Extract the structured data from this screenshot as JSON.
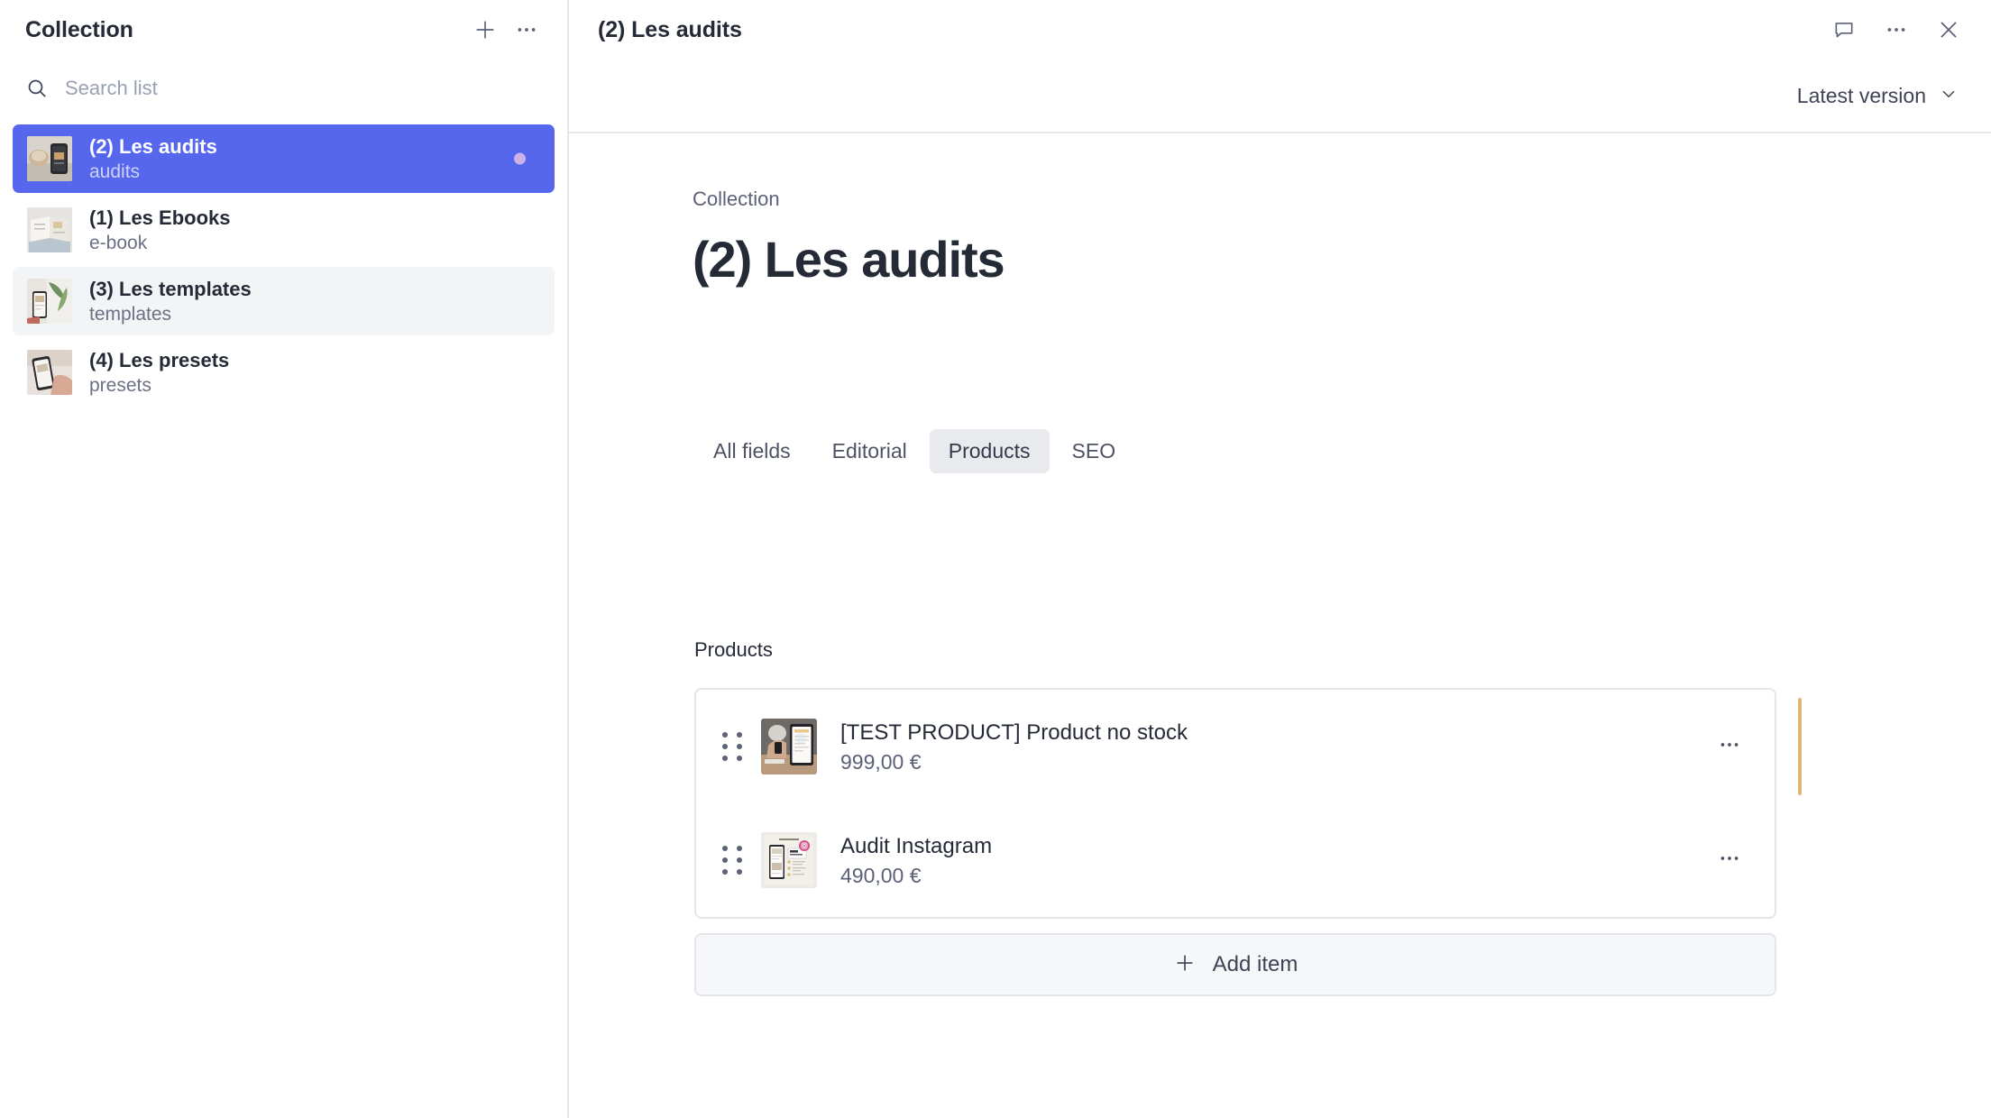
{
  "sidebar": {
    "title": "Collection",
    "add_button_icon": "plus-icon",
    "more_button_icon": "ellipsis-icon",
    "search": {
      "placeholder": "Search list",
      "value": "",
      "icon": "search-icon"
    },
    "items": [
      {
        "title": "(2) Les audits",
        "subtitle": "audits",
        "state": "selected",
        "has_dot": true,
        "thumbnail": "phone-coffee-photo"
      },
      {
        "title": "(1) Les Ebooks",
        "subtitle": "e-book",
        "state": "default",
        "has_dot": false,
        "thumbnail": "open-book-photo"
      },
      {
        "title": "(3) Les templates",
        "subtitle": "templates",
        "state": "hovered",
        "has_dot": false,
        "thumbnail": "phone-plant-photo"
      },
      {
        "title": "(4) Les presets",
        "subtitle": "presets",
        "state": "default",
        "has_dot": false,
        "thumbnail": "phone-hand-photo"
      }
    ]
  },
  "document_header": {
    "title": "(2) Les audits",
    "comment_icon": "comment-icon",
    "more_icon": "ellipsis-icon",
    "close_icon": "close-icon",
    "version_label": "Latest version",
    "version_chevron": "chevron-down-icon"
  },
  "document": {
    "breadcrumb": "Collection",
    "title": "(2) Les audits",
    "tabs": [
      {
        "label": "All fields",
        "active": false
      },
      {
        "label": "Editorial",
        "active": false
      },
      {
        "label": "Products",
        "active": true
      },
      {
        "label": "SEO",
        "active": false
      }
    ],
    "products_field": {
      "label": "Products",
      "items": [
        {
          "title": "[TEST PRODUCT] Product no stock",
          "price": "999,00 €",
          "thumbnail": "tablet-desk-photo",
          "drag_handle_icon": "drag-dots-icon",
          "menu_icon": "ellipsis-icon",
          "changed": true
        },
        {
          "title": "Audit Instagram",
          "price": "490,00 €",
          "thumbnail": "audit-instagram-photo",
          "drag_handle_icon": "drag-dots-icon",
          "menu_icon": "ellipsis-icon",
          "changed": false
        }
      ],
      "add_item_label": "Add item",
      "add_item_icon": "plus-icon"
    }
  },
  "colors": {
    "accent": "#5667ed",
    "selected_dot": "#cdb0e8",
    "change_indicator": "#ddb776",
    "hover_bg": "#f3f4f6",
    "border": "#e6e7ec",
    "text_primary": "#252a37",
    "text_secondary": "#5b6178"
  }
}
